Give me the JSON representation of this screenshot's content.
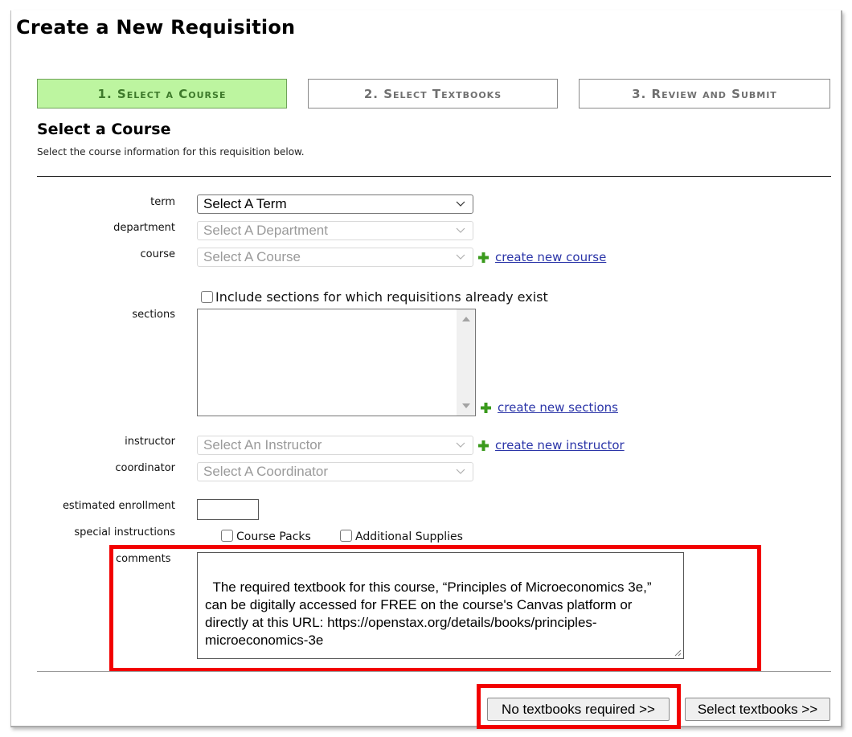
{
  "page": {
    "title": "Create a New Requisition"
  },
  "steps": [
    {
      "label": "1. Select a Course",
      "active": true
    },
    {
      "label": "2. Select Textbooks",
      "active": false
    },
    {
      "label": "3. Review and Submit",
      "active": false
    }
  ],
  "section": {
    "title": "Select a Course",
    "description": "Select the course information for this requisition below."
  },
  "form": {
    "term": {
      "label": "term",
      "value": "Select A Term",
      "disabled": false
    },
    "department": {
      "label": "department",
      "value": "Select A Department",
      "disabled": true
    },
    "course": {
      "label": "course",
      "value": "Select A Course",
      "disabled": true,
      "add_link": "create new course"
    },
    "include_existing": {
      "label": "Include sections for which requisitions already exist",
      "checked": false
    },
    "sections": {
      "label": "sections",
      "items": [],
      "add_link": "create new sections"
    },
    "instructor": {
      "label": "instructor",
      "value": "Select An Instructor",
      "disabled": true,
      "add_link": "create new instructor"
    },
    "coordinator": {
      "label": "coordinator",
      "value": "Select A Coordinator",
      "disabled": true
    },
    "estimated_enrollment": {
      "label": "estimated enrollment",
      "value": ""
    },
    "special_instructions": {
      "label": "special instructions",
      "options": [
        {
          "label": "Course Packs",
          "checked": false
        },
        {
          "label": "Additional Supplies",
          "checked": false
        }
      ]
    },
    "comments": {
      "label": "comments",
      "value": "The required textbook for this course, “Principles of Microeconomics 3e,” can be digitally accessed for FREE on the course's Canvas platform or directly at this URL: https://openstax.org/details/books/principles-microeconomics-3e"
    }
  },
  "buttons": {
    "no_textbooks": "No textbooks required >>",
    "select_textbooks": "Select textbooks >>"
  },
  "annotations": {
    "highlight_color": "#f20000",
    "highlighted": [
      "comments",
      "no_textbooks"
    ]
  },
  "colors": {
    "active_step_bg": "#bdf5a0",
    "active_step_text": "#3e7a2b",
    "link": "#2b35a8",
    "plus_icon": "#3a9a1c"
  }
}
